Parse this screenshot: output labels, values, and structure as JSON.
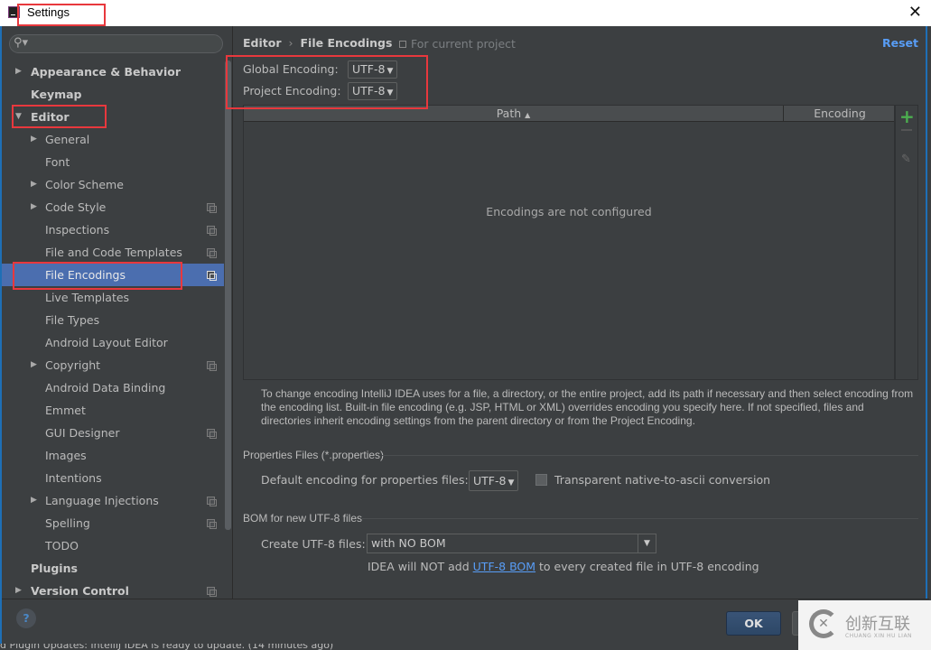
{
  "window": {
    "title": "Settings"
  },
  "search": {
    "placeholder": ""
  },
  "sidebar": {
    "items": [
      {
        "label": "Appearance & Behavior",
        "level": "top",
        "arrow": "▶",
        "project": false
      },
      {
        "label": "Keymap",
        "level": "top",
        "arrow": "",
        "project": false
      },
      {
        "label": "Editor",
        "level": "top",
        "arrow": "▼",
        "project": false
      },
      {
        "label": "General",
        "level": "sub",
        "arrow": "▶",
        "project": false
      },
      {
        "label": "Font",
        "level": "sub",
        "arrow": "",
        "project": false
      },
      {
        "label": "Color Scheme",
        "level": "sub",
        "arrow": "▶",
        "project": false
      },
      {
        "label": "Code Style",
        "level": "sub",
        "arrow": "▶",
        "project": true
      },
      {
        "label": "Inspections",
        "level": "sub",
        "arrow": "",
        "project": true
      },
      {
        "label": "File and Code Templates",
        "level": "sub",
        "arrow": "",
        "project": true
      },
      {
        "label": "File Encodings",
        "level": "sub",
        "arrow": "",
        "project": true,
        "selected": true
      },
      {
        "label": "Live Templates",
        "level": "sub",
        "arrow": "",
        "project": false
      },
      {
        "label": "File Types",
        "level": "sub",
        "arrow": "",
        "project": false
      },
      {
        "label": "Android Layout Editor",
        "level": "sub",
        "arrow": "",
        "project": false
      },
      {
        "label": "Copyright",
        "level": "sub",
        "arrow": "▶",
        "project": true
      },
      {
        "label": "Android Data Binding",
        "level": "sub",
        "arrow": "",
        "project": false
      },
      {
        "label": "Emmet",
        "level": "sub",
        "arrow": "",
        "project": false
      },
      {
        "label": "GUI Designer",
        "level": "sub",
        "arrow": "",
        "project": true
      },
      {
        "label": "Images",
        "level": "sub",
        "arrow": "",
        "project": false
      },
      {
        "label": "Intentions",
        "level": "sub",
        "arrow": "",
        "project": false
      },
      {
        "label": "Language Injections",
        "level": "sub",
        "arrow": "▶",
        "project": true
      },
      {
        "label": "Spelling",
        "level": "sub",
        "arrow": "",
        "project": true
      },
      {
        "label": "TODO",
        "level": "sub",
        "arrow": "",
        "project": false
      },
      {
        "label": "Plugins",
        "level": "top",
        "arrow": "",
        "project": false
      },
      {
        "label": "Version Control",
        "level": "top",
        "arrow": "▶",
        "project": true
      }
    ]
  },
  "main": {
    "breadcrumb": {
      "parent": "Editor",
      "separator": "›",
      "current": "File Encodings"
    },
    "scope_label": "For current project",
    "reset_label": "Reset",
    "global_encoding": {
      "label": "Global Encoding:",
      "value": "UTF-8"
    },
    "project_encoding": {
      "label": "Project Encoding:",
      "value": "UTF-8"
    },
    "table": {
      "columns": [
        {
          "label": "Path",
          "sort": "▲"
        },
        {
          "label": "Encoding"
        }
      ],
      "empty_text": "Encodings are not configured"
    },
    "help_text": "To change encoding IntelliJ IDEA uses for a file, a directory, or the entire project, add its path if necessary and then select encoding from the encoding list. Built-in file encoding (e.g. JSP, HTML or XML) overrides encoding you specify here. If not specified, files and directories inherit encoding settings from the parent directory or from the Project Encoding.",
    "properties": {
      "group_label": "Properties Files (*.properties)",
      "default_label": "Default encoding for properties files:",
      "default_value": "UTF-8",
      "transparent_label": "Transparent native-to-ascii conversion",
      "transparent_checked": false
    },
    "bom": {
      "group_label": "BOM for new UTF-8 files",
      "create_label": "Create UTF-8 files:",
      "create_value": "with NO BOM",
      "note_prefix": "IDEA will NOT add ",
      "note_link": "UTF-8 BOM",
      "note_suffix": " to every created file in UTF-8 encoding"
    }
  },
  "footer": {
    "help": "?",
    "ok_label": "OK"
  },
  "statusbar": {
    "text": "d Plugin Updates: IntelliJ IDEA is ready to update. (14 minutes ago)"
  },
  "watermark": {
    "cn": "创新互联",
    "en": "CHUANG XIN HU LIAN"
  },
  "colors": {
    "accent": "#4b6eaf",
    "link": "#589df6",
    "highlight_box": "#e8383d",
    "add": "#4cae4f"
  }
}
